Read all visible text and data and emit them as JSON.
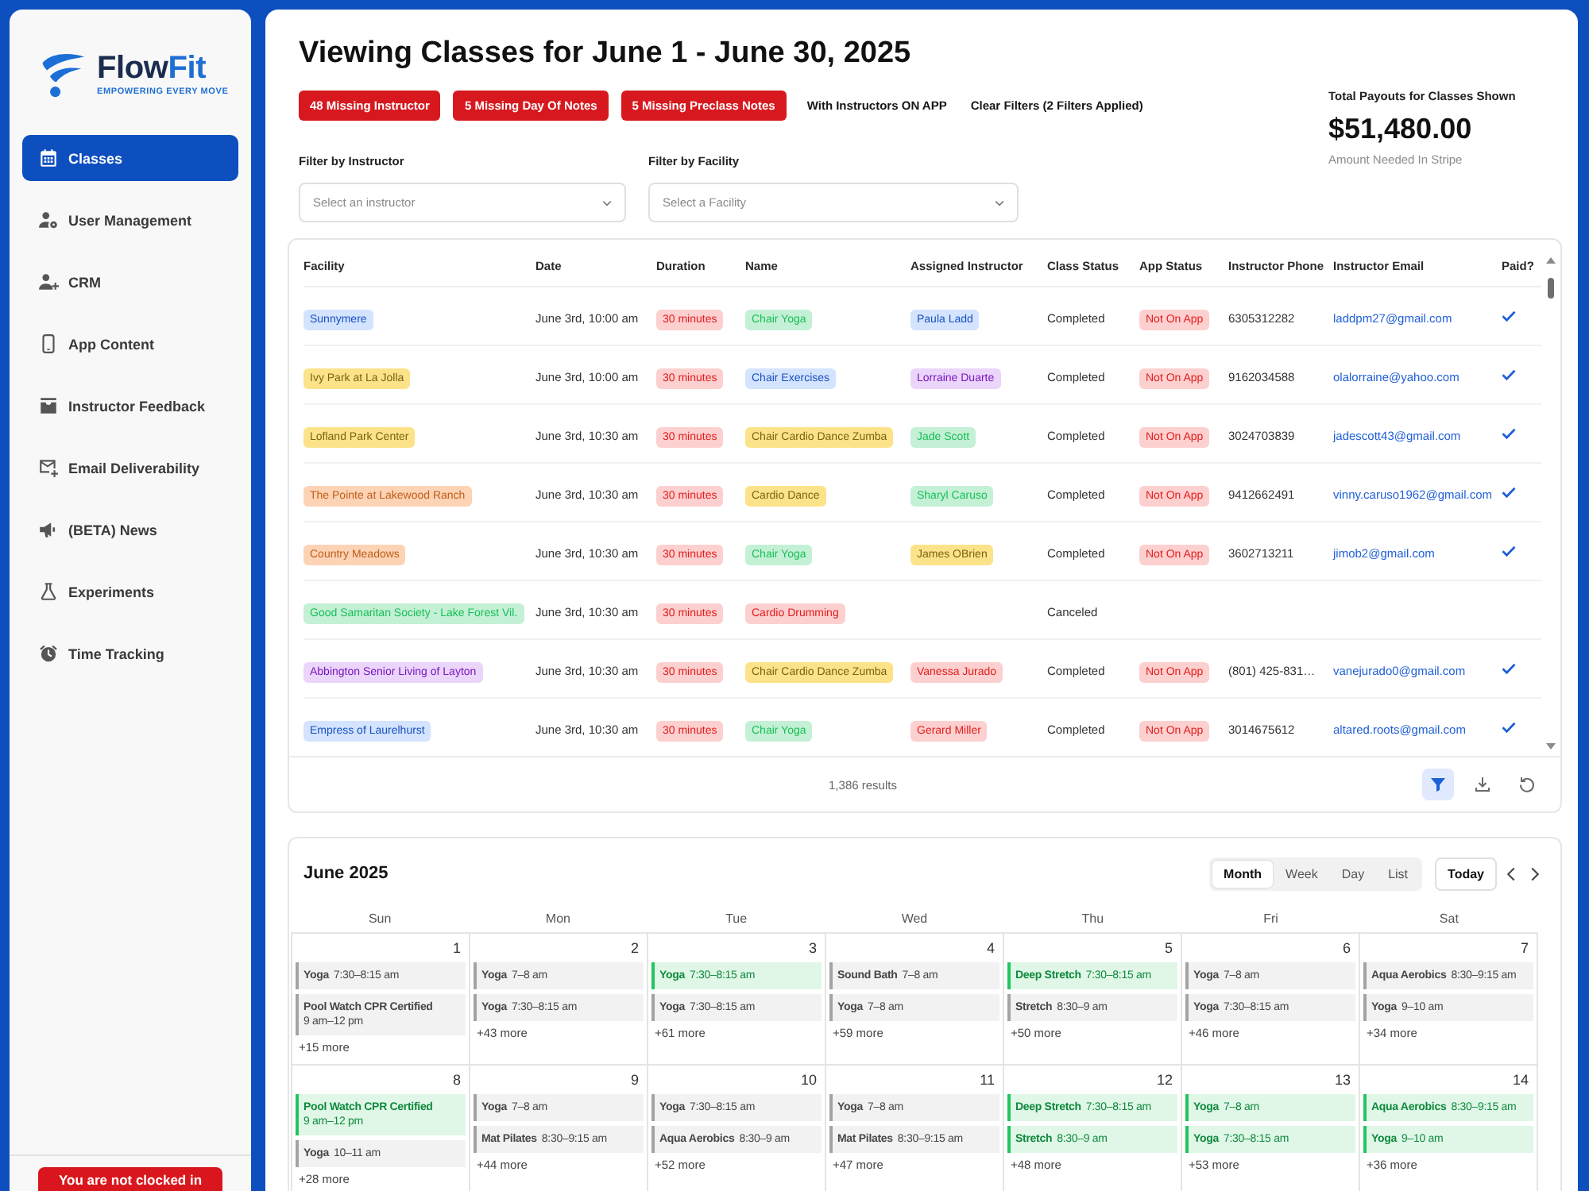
{
  "sidebar": {
    "brand": {
      "name": "Flow",
      "name_accent": "Fit",
      "tagline": "EMPOWERING EVERY MOVE"
    },
    "items": [
      {
        "label": "Classes",
        "selected": true
      },
      {
        "label": "User Management",
        "selected": false
      },
      {
        "label": "CRM",
        "selected": false
      },
      {
        "label": "App Content",
        "selected": false
      },
      {
        "label": "Instructor Feedback",
        "selected": false
      },
      {
        "label": "Email Deliverability",
        "selected": false
      },
      {
        "label": "(BETA) News",
        "selected": false
      },
      {
        "label": "Experiments",
        "selected": false
      },
      {
        "label": "Time Tracking",
        "selected": false
      }
    ],
    "clock_status": "You are not clocked in"
  },
  "header": {
    "title": "Viewing Classes for June 1 - June 30, 2025",
    "alerts": [
      "48 Missing Instructor",
      "5 Missing Day Of Notes",
      "5 Missing Preclass Notes"
    ],
    "filter_links": [
      "With Instructors ON APP",
      "Clear Filters (2 Filters Applied)"
    ],
    "payout": {
      "label": "Total Payouts for Classes Shown",
      "amount": "$51,480.00",
      "note": "Amount Needed In Stripe"
    }
  },
  "filters": [
    {
      "label": "Filter by Instructor",
      "placeholder": "Select an instructor"
    },
    {
      "label": "Filter by Facility",
      "placeholder": "Select a Facility"
    }
  ],
  "table": {
    "columns": [
      "Facility",
      "Date",
      "Duration",
      "Name",
      "Assigned Instructor",
      "Class Status",
      "App Status",
      "Instructor Phone",
      "Instructor Email",
      "Paid?"
    ],
    "rows": [
      {
        "facility": {
          "text": "Sunnymere",
          "color": "#d4e3fe"
        },
        "date": "June 3rd, 10:00 am",
        "duration": {
          "text": "30 minutes",
          "color": "#fdd0d0"
        },
        "name": {
          "text": "Chair Yoga",
          "color": "#c4f0d5"
        },
        "instructor": {
          "text": "Paula Ladd",
          "color": "#d4e3fe"
        },
        "class_status": "Completed",
        "app_status": {
          "text": "Not On App",
          "color": "#fdd0d0"
        },
        "phone": "6305312282",
        "email": "laddpm27@gmail.com",
        "paid": true
      },
      {
        "facility": {
          "text": "Ivy Park at La Jolla",
          "color": "#fce38a"
        },
        "date": "June 3rd, 10:00 am",
        "duration": {
          "text": "30 minutes",
          "color": "#fdd0d0"
        },
        "name": {
          "text": "Chair Exercises",
          "color": "#d4e3fe"
        },
        "instructor": {
          "text": "Lorraine Duarte",
          "color": "#ebd5fb"
        },
        "class_status": "Completed",
        "app_status": {
          "text": "Not On App",
          "color": "#fdd0d0"
        },
        "phone": "9162034588",
        "email": "olalorraine@yahoo.com",
        "paid": true
      },
      {
        "facility": {
          "text": "Lofland Park Center",
          "color": "#fce38a"
        },
        "date": "June 3rd, 10:30 am",
        "duration": {
          "text": "30 minutes",
          "color": "#fdd0d0"
        },
        "name": {
          "text": "Chair Cardio Dance Zumba",
          "color": "#fce38a"
        },
        "instructor": {
          "text": "Jade Scott",
          "color": "#c4f0d5"
        },
        "class_status": "Completed",
        "app_status": {
          "text": "Not On App",
          "color": "#fdd0d0"
        },
        "phone": "3024703839",
        "email": "jadescott43@gmail.com",
        "paid": true
      },
      {
        "facility": {
          "text": "The Pointe at Lakewood Ranch",
          "color": "#fdd3b5"
        },
        "date": "June 3rd, 10:30 am",
        "duration": {
          "text": "30 minutes",
          "color": "#fdd0d0"
        },
        "name": {
          "text": "Cardio Dance",
          "color": "#fce38a"
        },
        "instructor": {
          "text": "Sharyl Caruso",
          "color": "#c4f0d5"
        },
        "class_status": "Completed",
        "app_status": {
          "text": "Not On App",
          "color": "#fdd0d0"
        },
        "phone": "9412662491",
        "email": "vinny.caruso1962@gmail.com",
        "paid": true
      },
      {
        "facility": {
          "text": "Country Meadows",
          "color": "#fdd3b5"
        },
        "date": "June 3rd, 10:30 am",
        "duration": {
          "text": "30 minutes",
          "color": "#fdd0d0"
        },
        "name": {
          "text": "Chair Yoga",
          "color": "#c4f0d5"
        },
        "instructor": {
          "text": "James OBrien",
          "color": "#fce38a"
        },
        "class_status": "Completed",
        "app_status": {
          "text": "Not On App",
          "color": "#fdd0d0"
        },
        "phone": "3602713211",
        "email": "jimob2@gmail.com",
        "paid": true
      },
      {
        "facility": {
          "text": "Good Samaritan Society - Lake Forest Vil.",
          "color": "#c4f0d5"
        },
        "date": "June 3rd, 10:30 am",
        "duration": {
          "text": "30 minutes",
          "color": "#fdd0d0"
        },
        "name": {
          "text": "Cardio Drumming",
          "color": "#fdd0d0"
        },
        "class_status": "Canceled",
        "paid": false
      },
      {
        "facility": {
          "text": "Abbington Senior Living of Layton",
          "color": "#ebd5fb"
        },
        "date": "June 3rd, 10:30 am",
        "duration": {
          "text": "30 minutes",
          "color": "#fdd0d0"
        },
        "name": {
          "text": "Chair Cardio Dance Zumba",
          "color": "#fce38a"
        },
        "instructor": {
          "text": "Vanessa Jurado",
          "color": "#fdd0d0"
        },
        "class_status": "Completed",
        "app_status": {
          "text": "Not On App",
          "color": "#fdd0d0"
        },
        "phone": "(801) 425-831…",
        "email": "vanejurado0@gmail.com",
        "paid": true
      },
      {
        "facility": {
          "text": "Empress of Laurelhurst",
          "color": "#d4e3fe"
        },
        "date": "June 3rd, 10:30 am",
        "duration": {
          "text": "30 minutes",
          "color": "#fdd0d0"
        },
        "name": {
          "text": "Chair Yoga",
          "color": "#c4f0d5"
        },
        "instructor": {
          "text": "Gerard Miller",
          "color": "#fdd0d0"
        },
        "class_status": "Completed",
        "app_status": {
          "text": "Not On App",
          "color": "#fdd0d0"
        },
        "phone": "3014675612",
        "email": "altared.roots@gmail.com",
        "paid": true
      }
    ],
    "results": "1,386 results",
    "filter_active": true
  },
  "calendar": {
    "title": "June 2025",
    "views": [
      {
        "label": "Month",
        "selected": true
      },
      {
        "label": "Week",
        "selected": false
      },
      {
        "label": "Day",
        "selected": false
      },
      {
        "label": "List",
        "selected": false
      }
    ],
    "today": "Today",
    "weekdays": [
      "Sun",
      "Mon",
      "Tue",
      "Wed",
      "Thu",
      "Fri",
      "Sat"
    ],
    "weeks": [
      {
        "days": [
          {
            "day": "1",
            "events": [
              {
                "title": "Yoga",
                "time": "7:30–8:15 am",
                "color": "#a3a3a3"
              },
              {
                "title": "Pool Watch CPR Certified",
                "time": "9 am–12 pm",
                "color": "#a3a3a3"
              }
            ],
            "more": "+15 more"
          },
          {
            "day": "2",
            "events": [
              {
                "title": "Yoga",
                "time": "7–8 am",
                "color": "#a3a3a3"
              },
              {
                "title": "Yoga",
                "time": "7:30–8:15 am",
                "color": "#a3a3a3"
              }
            ],
            "more": "+43 more"
          },
          {
            "day": "3",
            "events": [
              {
                "title": "Yoga",
                "time": "7:30–8:15 am",
                "color": "#22c55e"
              },
              {
                "title": "Yoga",
                "time": "7:30–8:15 am",
                "color": "#a3a3a3"
              }
            ],
            "more": "+61 more"
          },
          {
            "day": "4",
            "events": [
              {
                "title": "Sound Bath",
                "time": "7–8 am",
                "color": "#a3a3a3"
              },
              {
                "title": "Yoga",
                "time": "7–8 am",
                "color": "#a3a3a3"
              }
            ],
            "more": "+59 more"
          },
          {
            "day": "5",
            "events": [
              {
                "title": "Deep Stretch",
                "time": "7:30–8:15 am",
                "color": "#22c55e"
              },
              {
                "title": "Stretch",
                "time": "8:30–9 am",
                "color": "#a3a3a3"
              }
            ],
            "more": "+50 more"
          },
          {
            "day": "6",
            "events": [
              {
                "title": "Yoga",
                "time": "7–8 am",
                "color": "#a3a3a3"
              },
              {
                "title": "Yoga",
                "time": "7:30–8:15 am",
                "color": "#a3a3a3"
              }
            ],
            "more": "+46 more"
          },
          {
            "day": "7",
            "events": [
              {
                "title": "Aqua Aerobics",
                "time": "8:30–9:15 am",
                "color": "#a3a3a3"
              },
              {
                "title": "Yoga",
                "time": "9–10 am",
                "color": "#a3a3a3"
              }
            ],
            "more": "+34 more"
          }
        ]
      },
      {
        "days": [
          {
            "day": "8",
            "events": [
              {
                "title": "Pool Watch CPR Certified",
                "time": "9 am–12 pm",
                "color": "#22c55e"
              },
              {
                "title": "Yoga",
                "time": "10–11 am",
                "color": "#a3a3a3"
              }
            ],
            "more": "+28 more"
          },
          {
            "day": "9",
            "events": [
              {
                "title": "Yoga",
                "time": "7–8 am",
                "color": "#a3a3a3"
              },
              {
                "title": "Mat Pilates",
                "time": "8:30–9:15 am",
                "color": "#a3a3a3"
              }
            ],
            "more": "+44 more"
          },
          {
            "day": "10",
            "events": [
              {
                "title": "Yoga",
                "time": "7:30–8:15 am",
                "color": "#a3a3a3"
              },
              {
                "title": "Aqua Aerobics",
                "time": "8:30–9 am",
                "color": "#a3a3a3"
              }
            ],
            "more": "+52 more"
          },
          {
            "day": "11",
            "events": [
              {
                "title": "Yoga",
                "time": "7–8 am",
                "color": "#a3a3a3"
              },
              {
                "title": "Mat Pilates",
                "time": "8:30–9:15 am",
                "color": "#a3a3a3"
              }
            ],
            "more": "+47 more"
          },
          {
            "day": "12",
            "events": [
              {
                "title": "Deep Stretch",
                "time": "7:30–8:15 am",
                "color": "#22c55e"
              },
              {
                "title": "Stretch",
                "time": "8:30–9 am",
                "color": "#22c55e"
              }
            ],
            "more": "+48 more"
          },
          {
            "day": "13",
            "events": [
              {
                "title": "Yoga",
                "time": "7–8 am",
                "color": "#22c55e"
              },
              {
                "title": "Yoga",
                "time": "7:30–8:15 am",
                "color": "#22c55e"
              }
            ],
            "more": "+53 more"
          },
          {
            "day": "14",
            "events": [
              {
                "title": "Aqua Aerobics",
                "time": "8:30–9:15 am",
                "color": "#22c55e"
              },
              {
                "title": "Yoga",
                "time": "9–10 am",
                "color": "#22c55e"
              }
            ],
            "more": "+36 more"
          }
        ]
      }
    ]
  }
}
